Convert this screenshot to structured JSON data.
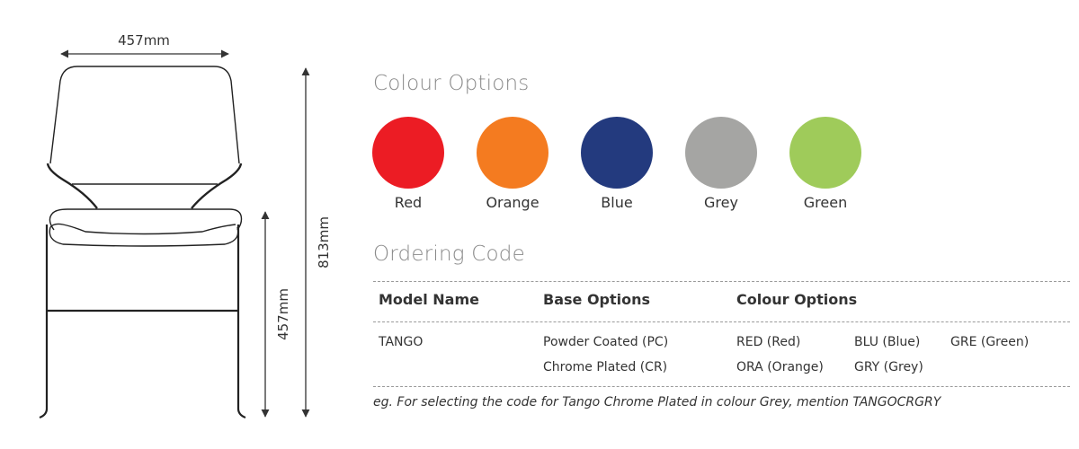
{
  "dimensions": {
    "width": "457mm",
    "total_height": "813mm",
    "seat_height": "457mm"
  },
  "colour_options": {
    "title": "Colour Options",
    "swatches": [
      {
        "name": "Red",
        "color": "#ec1c24"
      },
      {
        "name": "Orange",
        "color": "#f47b20"
      },
      {
        "name": "Blue",
        "color": "#233a7e"
      },
      {
        "name": "Grey",
        "color": "#a5a5a3"
      },
      {
        "name": "Green",
        "color": "#9fcb5a"
      }
    ]
  },
  "ordering_code": {
    "title": "Ordering Code",
    "headers": {
      "model_name": "Model Name",
      "base_options": "Base Options",
      "colour_options": "Colour Options"
    },
    "row": {
      "model": "TANGO",
      "base_options": [
        "Powder Coated (PC)",
        "Chrome Plated (CR)"
      ],
      "colour_codes": [
        "RED (Red)",
        "BLU (Blue)",
        "GRE (Green)",
        "ORA (Orange)",
        "GRY (Grey)"
      ]
    },
    "note": "eg. For selecting the code for Tango Chrome Plated in colour Grey, mention TANGOCRGRY"
  }
}
